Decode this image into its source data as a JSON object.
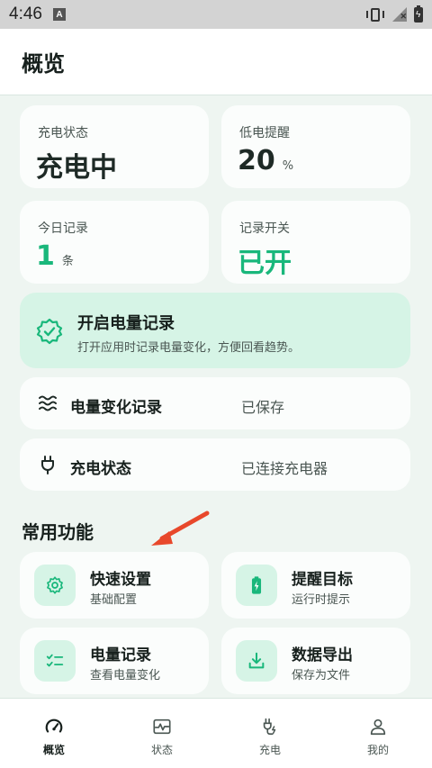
{
  "status_bar": {
    "time": "4:46",
    "badge": "A"
  },
  "app_bar": {
    "title": "概览"
  },
  "stats": [
    {
      "label": "充电状态",
      "value": "充电中",
      "unit": ""
    },
    {
      "label": "低电提醒",
      "value": "20",
      "unit": "%"
    },
    {
      "label": "今日记录",
      "value": "1",
      "unit": "条"
    },
    {
      "label": "记录开关",
      "value": "已开",
      "unit": ""
    }
  ],
  "banner": {
    "title": "开启电量记录",
    "desc": "打开应用时记录电量变化，方便回看趋势。",
    "icon": "verified-badge-icon"
  },
  "rows": [
    {
      "label": "电量变化记录",
      "value": "已保存",
      "icon": "waves-icon"
    },
    {
      "label": "充电状态",
      "value": "已连接充电器",
      "icon": "plug-icon"
    }
  ],
  "section": {
    "title": "常用功能"
  },
  "functions": [
    {
      "title": "快速设置",
      "subtitle": "基础配置",
      "icon": "gear-icon"
    },
    {
      "title": "提醒目标",
      "subtitle": "运行时提示",
      "icon": "battery-charging-icon"
    },
    {
      "title": "电量记录",
      "subtitle": "查看电量变化",
      "icon": "checklist-icon"
    },
    {
      "title": "数据导出",
      "subtitle": "保存为文件",
      "icon": "download-icon"
    }
  ],
  "nav": [
    {
      "label": "概览",
      "icon": "speedometer-icon",
      "active": true
    },
    {
      "label": "状态",
      "icon": "pulse-icon",
      "active": false
    },
    {
      "label": "充电",
      "icon": "charger-plug-icon",
      "active": false
    },
    {
      "label": "我的",
      "icon": "person-icon",
      "active": false
    }
  ],
  "colors": {
    "accent": "#19b77b",
    "accent_soft": "#d6f4e6",
    "background": "#eef5f1",
    "arrow": "#e8482b"
  }
}
